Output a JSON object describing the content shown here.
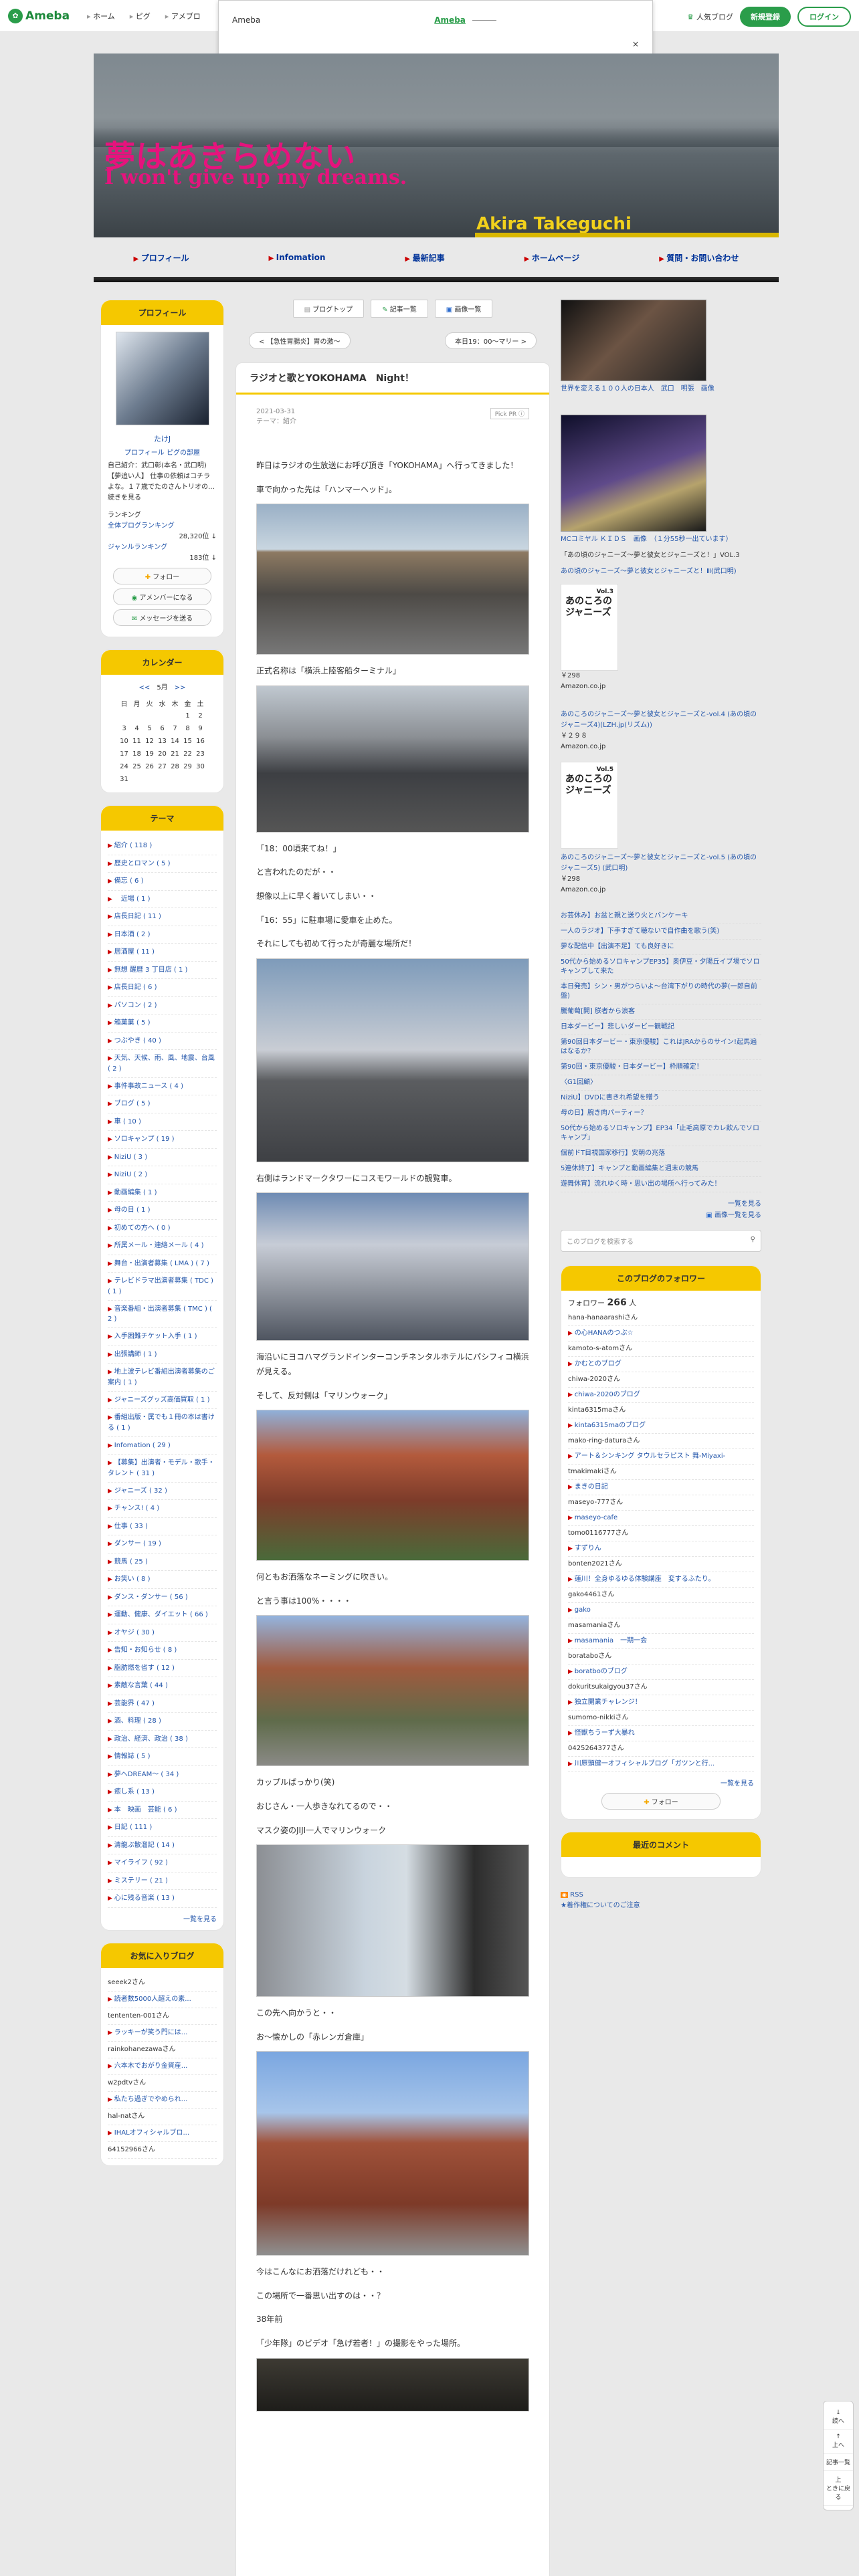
{
  "topbar": {
    "logo": "Ameba",
    "nav": [
      "ホーム",
      "ピグ",
      "アメブロ"
    ],
    "popular": "人気ブログ",
    "register": "新規登録",
    "login": "ログイン"
  },
  "dropdown": {
    "label": "Ameba",
    "name": "Ameba",
    "close": "×"
  },
  "header": {
    "title": "夢はあきらめない",
    "subtitle": "I won't give up my dreams.",
    "author": "Akira Takeguchi"
  },
  "gnav": [
    "プロフィール",
    "Infomation",
    "最新記事",
    "ホームページ",
    "質問・お問い合わせ"
  ],
  "profile": {
    "title": "プロフィール",
    "name": "たけJ",
    "links": "プロフィール ピグの部屋",
    "text": "自己紹介：武口彰(本名・武口明)　【夢追い人】 仕事の依頼はコチラよな。１７歳でたのさんトリオの…続きを見る",
    "rank_label": "ランキング",
    "rank_sub": "全体ブログランキング",
    "rank_val": "28,320位 ↓",
    "genre_label": "ジャンルランキング",
    "genre_val": "183位 ↓",
    "follow": "フォロー",
    "member": "アメンバーになる",
    "message": "メッセージを送る"
  },
  "calendar": {
    "title": "カレンダー",
    "month": "5月",
    "prev": "<<",
    "next": ">>",
    "weekdays": [
      "日",
      "月",
      "火",
      "水",
      "木",
      "金",
      "土"
    ],
    "rows": [
      [
        "",
        "",
        "",
        "",
        "",
        "1",
        "2"
      ],
      [
        "3",
        "4",
        "5",
        "6",
        "7",
        "8",
        "9"
      ],
      [
        "10",
        "11",
        "12",
        "13",
        "14",
        "15",
        "16"
      ],
      [
        "17",
        "18",
        "19",
        "20",
        "21",
        "22",
        "23"
      ],
      [
        "24",
        "25",
        "26",
        "27",
        "28",
        "29",
        "30"
      ],
      [
        "31",
        "",
        "",
        "",
        "",
        "",
        ""
      ]
    ]
  },
  "theme": {
    "title": "テーマ",
    "items": [
      "紹介 ( 118 )",
      "歴史とロマン ( 5 )",
      "備忘 ( 6 )",
      "　近場 ( 1 )",
      "店長日記 ( 11 )",
      "日本酒 ( 2 )",
      "居酒屋 ( 11 )",
      "無想 醒暦 3 丁目店 ( 1 )",
      "店長日記 ( 6 )",
      "パソコン ( 2 )",
      "箱菓菓 ( 5 )",
      "つぶやき ( 40 )",
      "天気、天候、雨、風、地震、台風 ( 2 )",
      "事件事故ニュース ( 4 )",
      "ブログ ( 5 )",
      "車 ( 10 )",
      "ソロキャンプ ( 19 )",
      "NiziU ( 3 )",
      "NiziU ( 2 )",
      "動画編集 ( 1 )",
      "母の日 ( 1 )",
      "初めての方へ ( 0 )",
      "所属メール・連絡メール ( 4 )",
      "舞台・出演者募集 ( LMA ) ( 7 )",
      "テレビドラマ出演者募集 ( TDC ) ( 1 )",
      "音楽番組・出演者募集 ( TMC ) ( 2 )",
      "入手困難チケット入手 ( 1 )",
      "出張講師 ( 1 )",
      "地上波テレビ番組出演者募集のご案内 ( 1 )",
      "ジャニーズグッズ高価買取 ( 1 )",
      "番組出版・属でも１冊の本は書ける ( 1 )",
      "Infomation ( 29 )",
      "【募集】出演者・モデル・歌手・タレント ( 31 )",
      "ジャニーズ ( 32 )",
      "チャンス! ( 4 )",
      "仕事 ( 33 )",
      "ダンサー ( 19 )",
      "競馬 ( 25 )",
      "お笑い ( 8 )",
      "ダンス・ダンサー ( 56 )",
      "運動、健康、ダイエット ( 66 )",
      "オヤジ ( 30 )",
      "告知・お知らせ ( 8 )",
      "脂肪燃を省す ( 12 )",
      "素敵な言葉 ( 44 )",
      "芸能界 ( 47 )",
      "酒、料理 ( 28 )",
      "政治、経済、政治 ( 38 )",
      "情報誌 ( 5 )",
      "夢へDREAM〜 ( 34 )",
      "癒し系 ( 13 )",
      "本　映画　芸能 ( 6 )",
      "日記 ( 111 )",
      "清龍ぶ散溜記 ( 14 )",
      "マイライフ ( 92 )",
      "ミステリー ( 21 )",
      "心に残る音楽 ( 13 )"
    ],
    "more": "一覧を見る"
  },
  "favorites": {
    "title": "お気に入りブログ",
    "items": [
      [
        "seeek2さん",
        ""
      ],
      [
        "",
        "読者数5000人超えの素..."
      ],
      [
        "tententen-001さん",
        ""
      ],
      [
        "",
        "ラッキーが笑う門には..."
      ],
      [
        "rainkohanezawaさん",
        ""
      ],
      [
        "",
        "六本木でおがり金資産..."
      ],
      [
        "w2pdtvさん",
        ""
      ],
      [
        "",
        "私たち過ぎでやめられ..."
      ],
      [
        "hal-natさん",
        ""
      ],
      [
        "",
        "IHALオフィシャルブロ..."
      ],
      [
        "64152966さん",
        ""
      ]
    ]
  },
  "tabs": [
    "ブログトップ",
    "記事一覧",
    "画像一覧"
  ],
  "pager": {
    "prev": "【急性胃腸炎】胃の激〜",
    "next": "本日19：00〜マリー"
  },
  "article": {
    "title": "ラジオと歌とYOKOHAMA　Night！",
    "date": "2021-03-31",
    "theme": "テーマ：紹介",
    "pr": "Pick PR ⓘ",
    "p1": "昨日はラジオの生放送にお呼び頂き「YOKOHAMA」へ行ってきました！",
    "p2": "車で向かった先は「ハンマーヘッド」。",
    "c1": "正式名称は「横浜上陸客船ターミナル」",
    "p3": "「18：00頃来てね！」",
    "p4": "と言われたのだが・・",
    "p5": "想像以上に早く着いてしまい・・",
    "p6": "「16：55」に駐車場に愛車を止めた。",
    "p7": "それにしても初めて行ったが奇麗な場所だ！",
    "c2": "右側はランドマークタワーにコスモワールドの観覧車。",
    "c3": "海沿いにヨコハマグランドインターコンチネンタルホテルにパシフィコ横浜が見える。",
    "p8": "そして、反対側は「マリンウォーク」",
    "c4": "何ともお洒落なネーミングに吹きい。",
    "p9": "と言う事は100%・・・・",
    "c5": "カップルばっかり(笑)",
    "p10": "おじさん・一人歩きなれてるので・・",
    "p11": "マスク姿のJIJI一人でマリンウォーク",
    "p12": "この先へ向かうと・・",
    "p13": "お〜懐かしの「赤レンガ倉庫」",
    "p14": "今はこんなにお洒落だけれども・・",
    "p15": "この場所で一番思い出すのは・・？",
    "p16": "38年前",
    "p17": "「少年隊」のビデオ「急げ若者！」の撮影をやった場所。"
  },
  "right": {
    "cap1": "世界を変える１００人の日本人　武口　明張　画像",
    "cap2": "MCコミヤル ＫＩＤＳ　画像　（１分55秒一出ています）",
    "cap3a": "「あの頃のジャニーズ〜夢と彼女とジャニーズと！」VOL.3",
    "cap3b": "あの頃のジャニーズ〜夢と彼女とジャニーズと！Ⅲ(武口明)",
    "vol3": "Vol.3",
    "book": "あのころのジャニーズ",
    "price1": "￥298",
    "amazon1": "Amazon.co.jp",
    "link4": "あのころのジャニーズ〜夢と彼女とジャニーズと-vol.4 (あの頃のジャニーズ4)(LZH.jp(リズム))",
    "price2": "￥２９８",
    "amazon2": "Amazon.co.jp",
    "vol5": "Vol.5",
    "link5": "あのころのジャニーズ〜夢と彼女とジャニーズと-vol.5 (あの頃のジャニーズ5) (武口明)",
    "price3": "￥298",
    "amazon3": "Amazon.co.jp",
    "entries": [
      "お芸休み】お盆と親と送り火とバンケーキ",
      "一人のラジオ】下手すぎて聴ないで自作曲を歌う(笑)",
      "夢な配信中【出演不足】ても良好きに",
      "50代から始めるソロキャンプEP35】奥伊豆・夕陽丘イブ場でソロキャンプして来た",
      "本日発売】シン・男がつらいよ〜台湾下がりの時代の夢(一郎自前盤)",
      "騰葡萄[開] 朕者から浪客",
      "日本ダービー】悲しいダービー観戦記",
      "第90回日本ダービー・東京優駿】これはJRAからのサイン!起馬遍はなるか？",
      "第90回・東京優駿・日本ダービー】枠順確定！",
      "〈G1回顧〉",
      "NiziU】DVDに書きれ希望を贈う",
      "母の日】腕き肉パーティー？",
      "50代から始めるソロキャンプ】EP34「止毛高原でカレ飲んでソロキャンプ」",
      "個前ドT目視国家移行】安朝の兆落",
      "5連休終了】キャンプと動画編集と週末の競馬",
      "遊舞休宵】流れゆく時・思い出の場所へ行ってみた！"
    ],
    "more1": "一覧を見る",
    "more2": "画像一覧を見る",
    "search": "このブログを検索する"
  },
  "followers": {
    "title": "このブログのフォロワー",
    "count_label": "フォロワー",
    "count": "266",
    "count_unit": "人",
    "items": [
      [
        "hana-hanaarashiさん",
        ""
      ],
      [
        "",
        "の心HANAのつぶ☆"
      ],
      [
        "kamoto-s-atomさん",
        ""
      ],
      [
        "",
        "かむとのブログ"
      ],
      [
        "chiwa-2020さん",
        ""
      ],
      [
        "",
        "chiwa-2020のブログ"
      ],
      [
        "kinta6315maさん",
        ""
      ],
      [
        "",
        "kinta6315maのブログ"
      ],
      [
        "mako-ring-daturaさん",
        ""
      ],
      [
        "",
        "アート＆シンキング タウルセラピスト 舞-Miyaxi-"
      ],
      [
        "tmakimakiさん",
        ""
      ],
      [
        "",
        "まきの日記"
      ],
      [
        "maseyo-777さん",
        ""
      ],
      [
        "",
        "maseyo-cafe"
      ],
      [
        "tomo0116777さん",
        ""
      ],
      [
        "",
        "すずりん"
      ],
      [
        "bonten2021さん",
        ""
      ],
      [
        "",
        "蓮川！全身ゆるゆる体験講座　変するふたり。"
      ],
      [
        "gako4461さん",
        ""
      ],
      [
        "",
        "gako"
      ],
      [
        "masamaniaさん",
        ""
      ],
      [
        "",
        "masamania　一期一会"
      ],
      [
        "borataboさん",
        ""
      ],
      [
        "",
        "boratboのブログ"
      ],
      [
        "dokuritsukaigyou37さん",
        ""
      ],
      [
        "",
        "独立開業チャレンジ！"
      ],
      [
        "sumomo-nikkiさん",
        ""
      ],
      [
        "",
        "怪獣ちうーず大暴れ"
      ],
      [
        "0425264377さん",
        ""
      ],
      [
        "",
        "川原頭健一オフィシャルブログ「ガツンと行..."
      ]
    ],
    "more": "一覧を見る",
    "follow": "フォロー"
  },
  "comments": {
    "title": "最近のコメント"
  },
  "rss": {
    "label": "RSS",
    "sub": "★着作権についてのご注意"
  },
  "tools": [
    "読へ",
    "↓",
    "上へ",
    "記事一覧",
    "上",
    "ときに戻る"
  ]
}
